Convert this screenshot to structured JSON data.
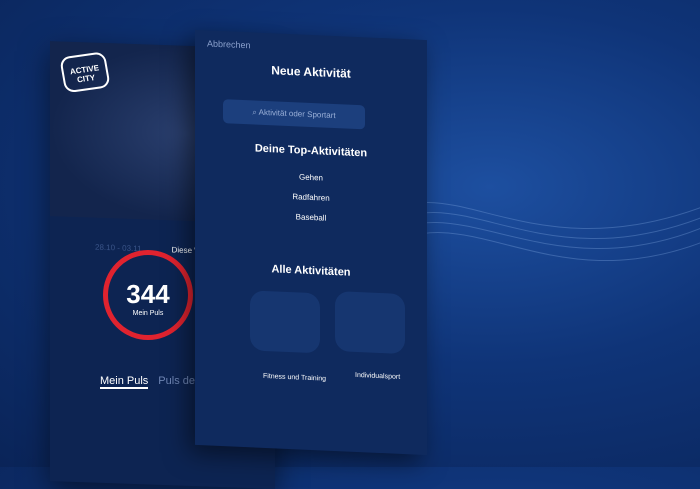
{
  "left_phone": {
    "logo": "ACTIVE CITY",
    "date_range": "28.10 - 03.11",
    "week_label": "Diese Woche",
    "pulse_value": "344",
    "pulse_label": "Mein Puls",
    "tabs": [
      "Mein Puls",
      "Puls der Stadt"
    ]
  },
  "right_phone": {
    "cancel": "Abbrechen",
    "title": "Neue Aktivität",
    "search_placeholder": "Aktivität oder Sportart",
    "top_heading": "Deine Top-Aktivitäten",
    "top_items": [
      "Gehen",
      "Radfahren",
      "Baseball"
    ],
    "all_heading": "Alle Aktivitäten",
    "categories": [
      "Fitness und Training",
      "Individualsport"
    ]
  },
  "colors": {
    "accent": "#e0232f",
    "bg": "#0f3478"
  }
}
